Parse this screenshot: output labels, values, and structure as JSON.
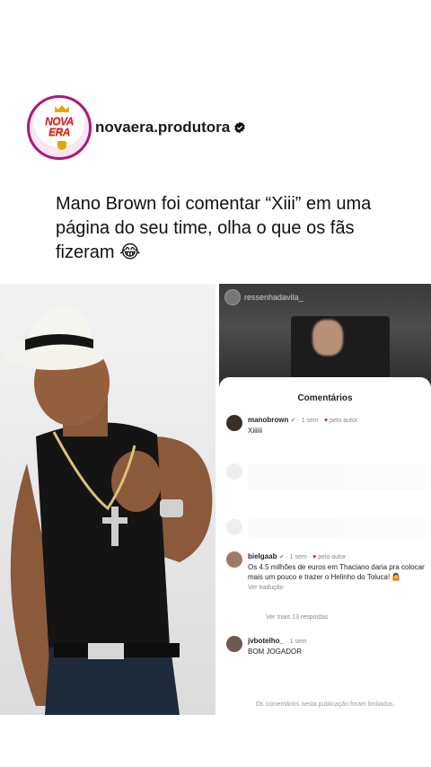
{
  "post": {
    "username": "novaera.produtora",
    "logo_text_1": "NOVA",
    "logo_text_2": "ERA",
    "caption": "Mano Brown foi comentar “Xiii” em uma página do seu time, olha o que os fãs fizeram 😂"
  },
  "screenshot": {
    "header_user": "ressenhadavila_",
    "sheet_title": "Comentários",
    "comments": [
      {
        "user": "manobrown",
        "time": "1 sem",
        "liked": "pelo autor",
        "text": "Xiiiiii"
      },
      {
        "user": "bielgaab",
        "time": "1 sem",
        "liked": "pelo autor",
        "text": "Os 4.5 milhões de euros em Thaciano daria pra colocar mais um pouco e trazer o Helinho do Toluca! 🤷",
        "translate": "Ver tradução",
        "replies": "Ver mais 13 respostas"
      },
      {
        "user": "jvbotelho_",
        "time": "1 sem",
        "text": "BOM JOGADOR"
      }
    ],
    "footer": "Os comentários nesta publicação foram limitados."
  }
}
